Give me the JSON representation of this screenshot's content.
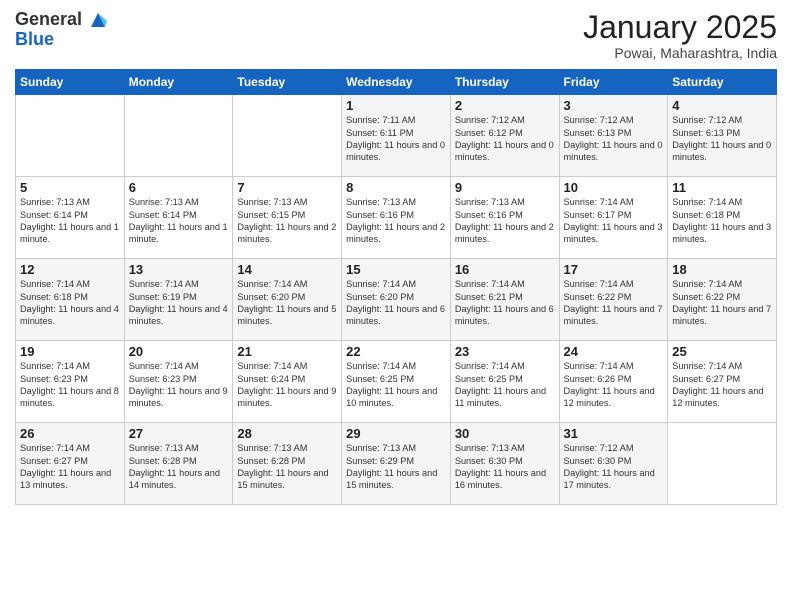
{
  "header": {
    "logo_general": "General",
    "logo_blue": "Blue",
    "month_title": "January 2025",
    "location": "Powai, Maharashtra, India"
  },
  "days_of_week": [
    "Sunday",
    "Monday",
    "Tuesday",
    "Wednesday",
    "Thursday",
    "Friday",
    "Saturday"
  ],
  "weeks": [
    [
      {
        "day": "",
        "sunrise": "",
        "sunset": "",
        "daylight": ""
      },
      {
        "day": "",
        "sunrise": "",
        "sunset": "",
        "daylight": ""
      },
      {
        "day": "",
        "sunrise": "",
        "sunset": "",
        "daylight": ""
      },
      {
        "day": "1",
        "sunrise": "Sunrise: 7:11 AM",
        "sunset": "Sunset: 6:11 PM",
        "daylight": "Daylight: 11 hours and 0 minutes."
      },
      {
        "day": "2",
        "sunrise": "Sunrise: 7:12 AM",
        "sunset": "Sunset: 6:12 PM",
        "daylight": "Daylight: 11 hours and 0 minutes."
      },
      {
        "day": "3",
        "sunrise": "Sunrise: 7:12 AM",
        "sunset": "Sunset: 6:13 PM",
        "daylight": "Daylight: 11 hours and 0 minutes."
      },
      {
        "day": "4",
        "sunrise": "Sunrise: 7:12 AM",
        "sunset": "Sunset: 6:13 PM",
        "daylight": "Daylight: 11 hours and 0 minutes."
      }
    ],
    [
      {
        "day": "5",
        "sunrise": "Sunrise: 7:13 AM",
        "sunset": "Sunset: 6:14 PM",
        "daylight": "Daylight: 11 hours and 1 minute."
      },
      {
        "day": "6",
        "sunrise": "Sunrise: 7:13 AM",
        "sunset": "Sunset: 6:14 PM",
        "daylight": "Daylight: 11 hours and 1 minute."
      },
      {
        "day": "7",
        "sunrise": "Sunrise: 7:13 AM",
        "sunset": "Sunset: 6:15 PM",
        "daylight": "Daylight: 11 hours and 2 minutes."
      },
      {
        "day": "8",
        "sunrise": "Sunrise: 7:13 AM",
        "sunset": "Sunset: 6:16 PM",
        "daylight": "Daylight: 11 hours and 2 minutes."
      },
      {
        "day": "9",
        "sunrise": "Sunrise: 7:13 AM",
        "sunset": "Sunset: 6:16 PM",
        "daylight": "Daylight: 11 hours and 2 minutes."
      },
      {
        "day": "10",
        "sunrise": "Sunrise: 7:14 AM",
        "sunset": "Sunset: 6:17 PM",
        "daylight": "Daylight: 11 hours and 3 minutes."
      },
      {
        "day": "11",
        "sunrise": "Sunrise: 7:14 AM",
        "sunset": "Sunset: 6:18 PM",
        "daylight": "Daylight: 11 hours and 3 minutes."
      }
    ],
    [
      {
        "day": "12",
        "sunrise": "Sunrise: 7:14 AM",
        "sunset": "Sunset: 6:18 PM",
        "daylight": "Daylight: 11 hours and 4 minutes."
      },
      {
        "day": "13",
        "sunrise": "Sunrise: 7:14 AM",
        "sunset": "Sunset: 6:19 PM",
        "daylight": "Daylight: 11 hours and 4 minutes."
      },
      {
        "day": "14",
        "sunrise": "Sunrise: 7:14 AM",
        "sunset": "Sunset: 6:20 PM",
        "daylight": "Daylight: 11 hours and 5 minutes."
      },
      {
        "day": "15",
        "sunrise": "Sunrise: 7:14 AM",
        "sunset": "Sunset: 6:20 PM",
        "daylight": "Daylight: 11 hours and 6 minutes."
      },
      {
        "day": "16",
        "sunrise": "Sunrise: 7:14 AM",
        "sunset": "Sunset: 6:21 PM",
        "daylight": "Daylight: 11 hours and 6 minutes."
      },
      {
        "day": "17",
        "sunrise": "Sunrise: 7:14 AM",
        "sunset": "Sunset: 6:22 PM",
        "daylight": "Daylight: 11 hours and 7 minutes."
      },
      {
        "day": "18",
        "sunrise": "Sunrise: 7:14 AM",
        "sunset": "Sunset: 6:22 PM",
        "daylight": "Daylight: 11 hours and 7 minutes."
      }
    ],
    [
      {
        "day": "19",
        "sunrise": "Sunrise: 7:14 AM",
        "sunset": "Sunset: 6:23 PM",
        "daylight": "Daylight: 11 hours and 8 minutes."
      },
      {
        "day": "20",
        "sunrise": "Sunrise: 7:14 AM",
        "sunset": "Sunset: 6:23 PM",
        "daylight": "Daylight: 11 hours and 9 minutes."
      },
      {
        "day": "21",
        "sunrise": "Sunrise: 7:14 AM",
        "sunset": "Sunset: 6:24 PM",
        "daylight": "Daylight: 11 hours and 9 minutes."
      },
      {
        "day": "22",
        "sunrise": "Sunrise: 7:14 AM",
        "sunset": "Sunset: 6:25 PM",
        "daylight": "Daylight: 11 hours and 10 minutes."
      },
      {
        "day": "23",
        "sunrise": "Sunrise: 7:14 AM",
        "sunset": "Sunset: 6:25 PM",
        "daylight": "Daylight: 11 hours and 11 minutes."
      },
      {
        "day": "24",
        "sunrise": "Sunrise: 7:14 AM",
        "sunset": "Sunset: 6:26 PM",
        "daylight": "Daylight: 11 hours and 12 minutes."
      },
      {
        "day": "25",
        "sunrise": "Sunrise: 7:14 AM",
        "sunset": "Sunset: 6:27 PM",
        "daylight": "Daylight: 11 hours and 12 minutes."
      }
    ],
    [
      {
        "day": "26",
        "sunrise": "Sunrise: 7:14 AM",
        "sunset": "Sunset: 6:27 PM",
        "daylight": "Daylight: 11 hours and 13 minutes."
      },
      {
        "day": "27",
        "sunrise": "Sunrise: 7:13 AM",
        "sunset": "Sunset: 6:28 PM",
        "daylight": "Daylight: 11 hours and 14 minutes."
      },
      {
        "day": "28",
        "sunrise": "Sunrise: 7:13 AM",
        "sunset": "Sunset: 6:28 PM",
        "daylight": "Daylight: 11 hours and 15 minutes."
      },
      {
        "day": "29",
        "sunrise": "Sunrise: 7:13 AM",
        "sunset": "Sunset: 6:29 PM",
        "daylight": "Daylight: 11 hours and 15 minutes."
      },
      {
        "day": "30",
        "sunrise": "Sunrise: 7:13 AM",
        "sunset": "Sunset: 6:30 PM",
        "daylight": "Daylight: 11 hours and 16 minutes."
      },
      {
        "day": "31",
        "sunrise": "Sunrise: 7:12 AM",
        "sunset": "Sunset: 6:30 PM",
        "daylight": "Daylight: 11 hours and 17 minutes."
      },
      {
        "day": "",
        "sunrise": "",
        "sunset": "",
        "daylight": ""
      }
    ]
  ]
}
